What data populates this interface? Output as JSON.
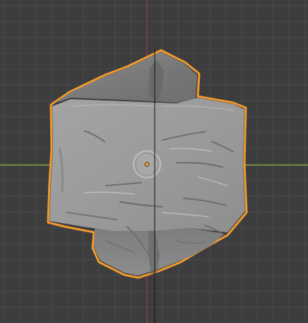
{
  "viewport": {
    "view": "3d-viewport",
    "background_color": "#3d3d3d",
    "grid": true,
    "grid_color": "#4a4a4a",
    "axes": {
      "x_axis_color": "#8ab43c",
      "y_axis_color": "#9a3a48",
      "z_axis_color": "#1a1a1a"
    }
  },
  "object": {
    "selected": true,
    "selection_outline_color": "#f29a2e",
    "mesh_color": "#9a9a9a",
    "mesh_shading": "sculpted-rock",
    "origin_color": "#f29a2e",
    "gizmo": "object-origin"
  }
}
